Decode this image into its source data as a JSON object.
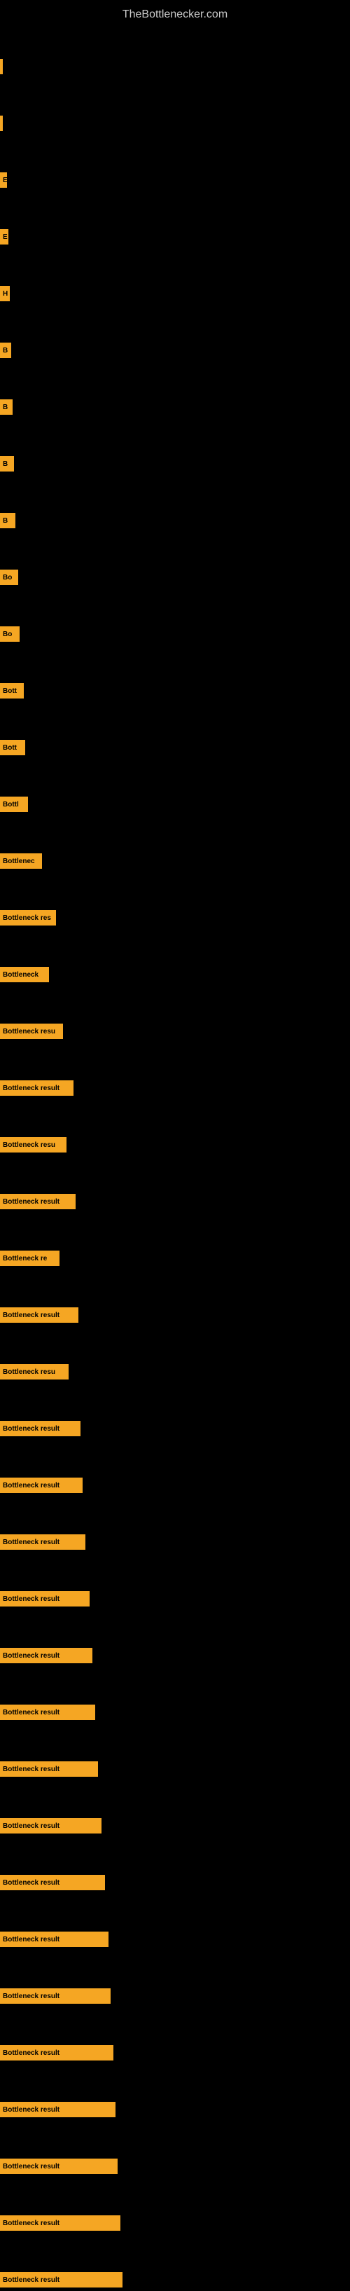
{
  "site": {
    "title": "TheBottlenecker.com"
  },
  "bars": [
    {
      "id": 1,
      "label": "",
      "width": 4
    },
    {
      "id": 2,
      "label": "",
      "width": 4
    },
    {
      "id": 3,
      "label": "E",
      "width": 10
    },
    {
      "id": 4,
      "label": "E",
      "width": 12
    },
    {
      "id": 5,
      "label": "H",
      "width": 14
    },
    {
      "id": 6,
      "label": "B",
      "width": 16
    },
    {
      "id": 7,
      "label": "B",
      "width": 18
    },
    {
      "id": 8,
      "label": "B",
      "width": 20
    },
    {
      "id": 9,
      "label": "B",
      "width": 22
    },
    {
      "id": 10,
      "label": "Bo",
      "width": 26
    },
    {
      "id": 11,
      "label": "Bo",
      "width": 28
    },
    {
      "id": 12,
      "label": "Bott",
      "width": 34
    },
    {
      "id": 13,
      "label": "Bott",
      "width": 36
    },
    {
      "id": 14,
      "label": "Bottl",
      "width": 40
    },
    {
      "id": 15,
      "label": "Bottlenec",
      "width": 60
    },
    {
      "id": 16,
      "label": "Bottleneck res",
      "width": 80
    },
    {
      "id": 17,
      "label": "Bottleneck",
      "width": 70
    },
    {
      "id": 18,
      "label": "Bottleneck resu",
      "width": 90
    },
    {
      "id": 19,
      "label": "Bottleneck result",
      "width": 105
    },
    {
      "id": 20,
      "label": "Bottleneck resu",
      "width": 95
    },
    {
      "id": 21,
      "label": "Bottleneck result",
      "width": 108
    },
    {
      "id": 22,
      "label": "Bottleneck re",
      "width": 85
    },
    {
      "id": 23,
      "label": "Bottleneck result",
      "width": 112
    },
    {
      "id": 24,
      "label": "Bottleneck resu",
      "width": 98
    },
    {
      "id": 25,
      "label": "Bottleneck result",
      "width": 115
    },
    {
      "id": 26,
      "label": "Bottleneck result",
      "width": 118
    },
    {
      "id": 27,
      "label": "Bottleneck result",
      "width": 122
    },
    {
      "id": 28,
      "label": "Bottleneck result",
      "width": 128
    },
    {
      "id": 29,
      "label": "Bottleneck result",
      "width": 132
    },
    {
      "id": 30,
      "label": "Bottleneck result",
      "width": 136
    },
    {
      "id": 31,
      "label": "Bottleneck result",
      "width": 140
    },
    {
      "id": 32,
      "label": "Bottleneck result",
      "width": 145
    },
    {
      "id": 33,
      "label": "Bottleneck result",
      "width": 150
    },
    {
      "id": 34,
      "label": "Bottleneck result",
      "width": 155
    },
    {
      "id": 35,
      "label": "Bottleneck result",
      "width": 158
    },
    {
      "id": 36,
      "label": "Bottleneck result",
      "width": 162
    },
    {
      "id": 37,
      "label": "Bottleneck result",
      "width": 165
    },
    {
      "id": 38,
      "label": "Bottleneck result",
      "width": 168
    },
    {
      "id": 39,
      "label": "Bottleneck result",
      "width": 172
    },
    {
      "id": 40,
      "label": "Bottleneck result",
      "width": 175
    }
  ]
}
